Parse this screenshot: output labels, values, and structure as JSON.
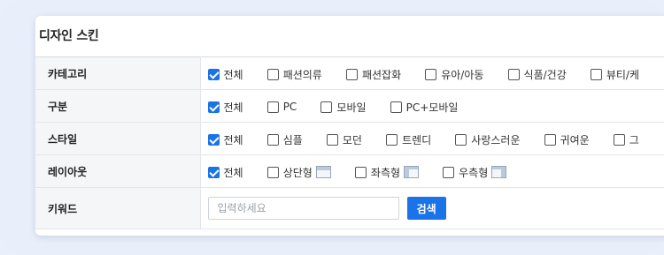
{
  "title": "디자인 스킨",
  "rows": [
    {
      "label": "카테고리",
      "options": [
        {
          "label": "전체",
          "checked": true
        },
        {
          "label": "패션의류",
          "checked": false
        },
        {
          "label": "패션잡화",
          "checked": false
        },
        {
          "label": "유아/아동",
          "checked": false
        },
        {
          "label": "식품/건강",
          "checked": false
        },
        {
          "label": "뷰티/케",
          "checked": false
        }
      ]
    },
    {
      "label": "구분",
      "options": [
        {
          "label": "전체",
          "checked": true
        },
        {
          "label": "PC",
          "checked": false
        },
        {
          "label": "모바일",
          "checked": false
        },
        {
          "label": "PC+모바일",
          "checked": false
        }
      ]
    },
    {
      "label": "스타일",
      "options": [
        {
          "label": "전체",
          "checked": true
        },
        {
          "label": "심플",
          "checked": false
        },
        {
          "label": "모던",
          "checked": false
        },
        {
          "label": "트렌디",
          "checked": false
        },
        {
          "label": "사랑스러운",
          "checked": false
        },
        {
          "label": "귀여운",
          "checked": false
        },
        {
          "label": "그",
          "checked": false
        }
      ]
    },
    {
      "label": "레이아웃",
      "options": [
        {
          "label": "전체",
          "checked": true
        },
        {
          "label": "상단형",
          "checked": false,
          "icon": "layout-top-icon"
        },
        {
          "label": "좌측형",
          "checked": false,
          "icon": "layout-left-icon"
        },
        {
          "label": "우측형",
          "checked": false,
          "icon": "layout-right-icon"
        }
      ]
    }
  ],
  "keyword": {
    "label": "키워드",
    "placeholder": "입력하세요",
    "value": "",
    "button": "검색"
  },
  "colors": {
    "accent": "#1a73e8",
    "header_bg": "#f5f6f8",
    "frame_bg": "#e9effa"
  }
}
